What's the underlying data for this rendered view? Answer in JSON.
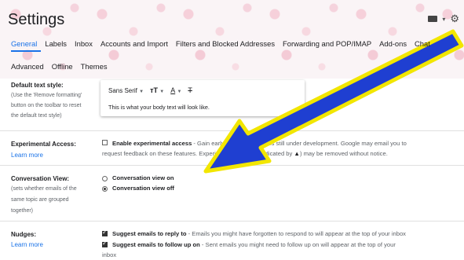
{
  "header": {
    "title": "Settings"
  },
  "tabs_row1": [
    "General",
    "Labels",
    "Inbox",
    "Accounts and Import",
    "Filters and Blocked Addresses",
    "Forwarding and POP/IMAP",
    "Add-ons",
    "Chat"
  ],
  "tabs_row2": [
    "Advanced",
    "Offline",
    "Themes"
  ],
  "default_text_style": {
    "label": "Default text style:",
    "desc1": "(Use the 'Remove formatting'",
    "desc2": "button on the toolbar to reset",
    "desc3": "the default text style)",
    "font": "Sans Serif",
    "sample": "This is what your body text will look like."
  },
  "experimental": {
    "label": "Experimental Access:",
    "link": "Learn more",
    "option_label": "Enable experimental access",
    "text1": " - Gain early access to features still under development. Google may email you to",
    "text2": "request feedback on these features. Experimental features (indicated by ",
    "text2_icon": "▲",
    "text2_end": ") may be removed without notice."
  },
  "conversation": {
    "label": "Conversation View:",
    "desc1": "(sets whether emails of the",
    "desc2": "same topic are grouped",
    "desc3": "together)",
    "option_on": "Conversation view on",
    "option_off": "Conversation view off",
    "selected": "off"
  },
  "nudges": {
    "label": "Nudges:",
    "link": "Learn more",
    "opt1_label": "Suggest emails to reply to",
    "opt1_text": " - Emails you might have forgotten to respond to will appear at the top of your inbox",
    "opt2_label": "Suggest emails to follow up on",
    "opt2_text": " - Sent emails you might need to follow up on will appear at the top of your",
    "opt2_text2": "inbox"
  },
  "colors": {
    "accent": "#1a73e8",
    "arrow_fill": "#1f3fd1",
    "arrow_outline": "#f2e600"
  }
}
